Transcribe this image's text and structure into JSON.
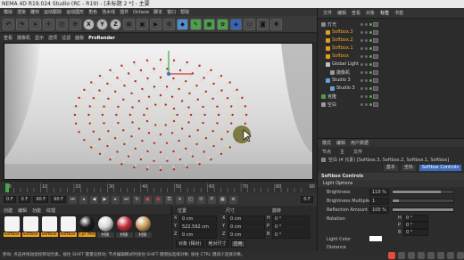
{
  "window": {
    "title": "NEMA 4D R19.024 Studio (RC - R19) - [未标题 2 *] - 主要"
  },
  "menubar": {
    "items": [
      "模拟",
      "渲染",
      "雕刻",
      "运动跟踪",
      "运动图形",
      "角色",
      "流水线",
      "插件",
      "Octane",
      "脚本",
      "窗口",
      "帮助"
    ]
  },
  "toolbar": {
    "axis_labels": [
      "X",
      "Y",
      "Z"
    ]
  },
  "viewport": {
    "menu": [
      "查看",
      "摄像机",
      "显示",
      "选项",
      "过滤",
      "面板"
    ],
    "renderer": "ProRender"
  },
  "timeline": {
    "ticks": [
      "0",
      "10",
      "20",
      "30",
      "40",
      "50",
      "60",
      "70",
      "80",
      "90"
    ],
    "start_field": "0 F",
    "current_field": "0 F",
    "end_field": "90 F",
    "end_field2": "90 F",
    "frame_display": "0 F"
  },
  "materials": {
    "menu": [
      "创建",
      "编辑",
      "功能",
      "纹理"
    ],
    "items": [
      {
        "label": "Softbox",
        "color": "#f4f4f4",
        "highlight": true
      },
      {
        "label": "Softbox",
        "color": "#f4f4f4",
        "highlight": true
      },
      {
        "label": "Softbox",
        "color": "#f4f4f4",
        "highlight": true
      },
      {
        "label": "Softbox",
        "color": "#f4f4f4",
        "highlight": true
      },
      {
        "label": "Cyc Mat",
        "color": "#1a1a1a",
        "highlight": true
      },
      {
        "label": "材质",
        "color": "#d8d8d8",
        "highlight": false
      },
      {
        "label": "材质",
        "color": "#c0303a",
        "highlight": false
      },
      {
        "label": "材质",
        "color": "#c89a5a",
        "highlight": false
      }
    ]
  },
  "coordinates": {
    "headers": [
      "位置",
      "尺寸",
      "旋转"
    ],
    "rows": [
      {
        "axis": "X",
        "pos": "0 cm",
        "size_axis": "X",
        "size": "0 cm",
        "rot_axis": "H",
        "rot": "0 °"
      },
      {
        "axis": "Y",
        "pos": "522.592 cm",
        "size_axis": "Y",
        "size": "0 cm",
        "rot_axis": "P",
        "rot": "0 °"
      },
      {
        "axis": "Z",
        "pos": "0 cm",
        "size_axis": "Z",
        "size": "0 cm",
        "rot_axis": "B",
        "rot": "0 °"
      }
    ],
    "mode_select": "对象 (相对)",
    "size_select": "绝对尺寸",
    "apply_button": "应用"
  },
  "status": {
    "text": "移动: 点击并拖动鼠标移动元素。按住 SHIFT 键量化移动; 节点编辑模式时按住 SHIFT 键增加选择对象; 按住 CTRL 键减少选择对象。"
  },
  "objects": {
    "tabs": [
      "文件",
      "编辑",
      "查看",
      "对象",
      "标签",
      "书签"
    ],
    "rows": [
      {
        "name": "灯光",
        "selected": false,
        "icon": "#8a8a8a",
        "indent": 0
      },
      {
        "name": "Softbox.3",
        "selected": true,
        "icon": "#e0a020",
        "indent": 1
      },
      {
        "name": "Softbox.2",
        "selected": true,
        "icon": "#e0a020",
        "indent": 1
      },
      {
        "name": "Softbox.1",
        "selected": true,
        "icon": "#e0a020",
        "indent": 1
      },
      {
        "name": "Softbox",
        "selected": true,
        "icon": "#e0a020",
        "indent": 1
      },
      {
        "name": "Global Light",
        "selected": false,
        "icon": "#c0c0c0",
        "indent": 1
      },
      {
        "name": "摄像机",
        "selected": false,
        "icon": "#9a9a9a",
        "indent": 2
      },
      {
        "name": "Studio 3",
        "selected": false,
        "icon": "#6aa0d8",
        "indent": 1
      },
      {
        "name": "Studio 3",
        "selected": false,
        "icon": "#6aa0d8",
        "indent": 2
      },
      {
        "name": "克隆",
        "selected": false,
        "icon": "#4f9e4b",
        "indent": 0
      },
      {
        "name": "空白",
        "selected": false,
        "icon": "#9a9a9a",
        "indent": 0
      }
    ]
  },
  "attributes": {
    "tabs": [
      "模式",
      "编辑",
      "用户数据"
    ],
    "mode_tabs": [
      "节点",
      "主",
      "文件"
    ],
    "object_line": "空白 (4 元素) [Softbox.3, Softbox.2, Softbox.1, Softbox]",
    "subtabs": [
      "基本",
      "坐标",
      "Softbox Controls"
    ],
    "section_title": "Softbox Controls",
    "subsection": "Light Options",
    "fields": [
      {
        "label": "Brightness",
        "value": "110 %",
        "fill": 0.8
      },
      {
        "label": "Brightness Multiplier",
        "value": "1",
        "fill": 0.1
      },
      {
        "label": "Reflection Amount",
        "value": "100 %",
        "fill": 1.0
      },
      {
        "label": "Rotation",
        "value": "",
        "fill": null
      }
    ],
    "rotation": [
      {
        "axis": "H",
        "value": "0 °"
      },
      {
        "axis": "P",
        "value": "0 °"
      },
      {
        "axis": "B",
        "value": "0 °"
      }
    ],
    "light_color_label": "Light Color",
    "distance_label": "Distance"
  }
}
